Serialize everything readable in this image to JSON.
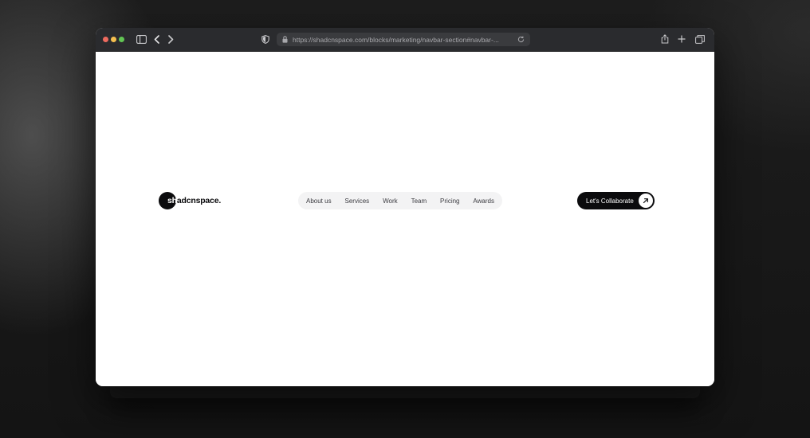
{
  "browser": {
    "url": "https://shadcnspace.com/blocks/marketing/navbar-section#navbar-...",
    "icons": {
      "sidebar": "sidebar-toggle-icon",
      "back": "chevron-left-icon",
      "forward": "chevron-right-icon",
      "privacy": "shield-icon",
      "lock": "lock-icon",
      "reload": "reload-icon",
      "share": "share-icon",
      "new_tab": "plus-icon",
      "tabs": "tabs-overview-icon"
    }
  },
  "navbar": {
    "logo": {
      "first": "sh",
      "rest": "adcnspace."
    },
    "items": [
      {
        "label": "About us"
      },
      {
        "label": "Services"
      },
      {
        "label": "Work"
      },
      {
        "label": "Team"
      },
      {
        "label": "Pricing"
      },
      {
        "label": "Awards"
      }
    ],
    "cta": {
      "label": "Let's Collaborate",
      "icon": "arrow-up-right-icon"
    }
  },
  "colors": {
    "brand_dark": "#0b0b0d",
    "nav_pill": "#f3f3f4",
    "titlebar": "#2a2b2e"
  }
}
